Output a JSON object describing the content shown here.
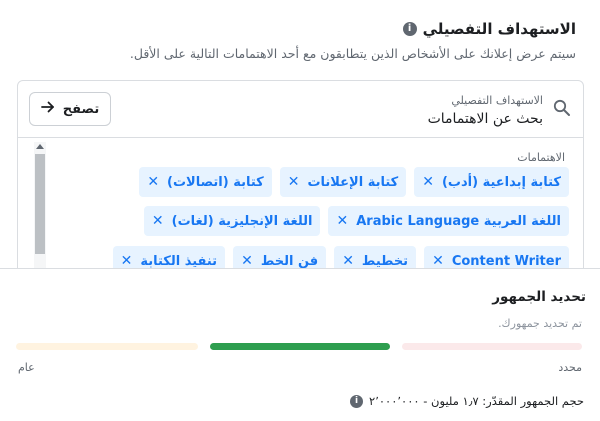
{
  "targeting": {
    "title": "الاستهداف التفصيلي",
    "info_icon": "info-icon",
    "subtitle": "سيتم عرض إعلانك على الأشخاص الذين يتطابقون مع أحد الاهتمامات التالية على الأقل.",
    "search": {
      "label": "الاستهداف التفصيلي",
      "placeholder": "بحث عن الاهتمامات",
      "icon": "search-icon"
    },
    "browse_button": {
      "label": "تصفح",
      "icon": "arrow-right-icon"
    },
    "interests_label": "الاهتمامات",
    "chip_rows": [
      [
        "كتابة إبداعية (أدب)",
        "كتابة الإعلانات",
        "كتابة (اتصالات)"
      ],
      [
        "اللغة العربية Arabic Language",
        "اللغة الإنجليزية (لغات)"
      ],
      [
        "Content Writer",
        "تخطيط",
        "فن الخط",
        "تنفيذ الكتابة"
      ]
    ]
  },
  "audience": {
    "title": "تحديد الجمهور",
    "status": "تم تحديد جمهورك.",
    "meter": {
      "left_label": "عام",
      "right_label": "محدد",
      "active_segment": "middle",
      "colors": {
        "left": "#fff3e0",
        "middle": "#2e9e4f",
        "right": "#fbe9ea"
      }
    },
    "size_text": "حجم الجمهور المقدّر: ١٫٧ مليون - ٢٬٠٠٠٬٠٠٠"
  },
  "colors": {
    "chip_bg": "#e7f3ff",
    "chip_text": "#1877f2",
    "page_bg": "#f0f2f5"
  }
}
